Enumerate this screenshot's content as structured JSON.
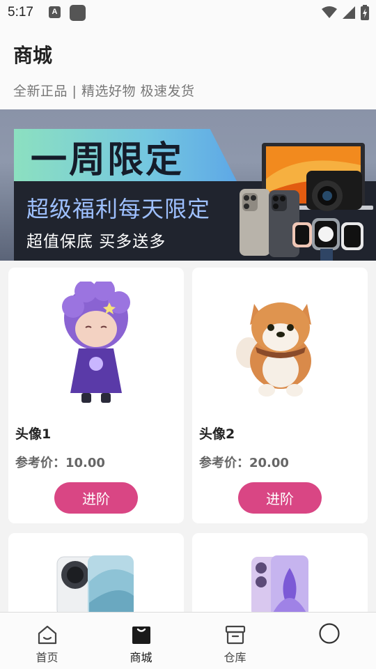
{
  "status_bar": {
    "time": "5:17",
    "a_icon": "A"
  },
  "header": {
    "title": "商城",
    "subtitle": "全新正品 | 精选好物 极速发货"
  },
  "banner": {
    "headline": "一周限定",
    "line1": "超级福利每天限定",
    "line2": "超值保底 买多送多"
  },
  "products": [
    {
      "name": "头像1",
      "price": "参考价：10.00",
      "button": "进阶",
      "icon": "purple-hair-figurine-image"
    },
    {
      "name": "头像2",
      "price": "参考价：20.00",
      "button": "进阶",
      "icon": "shiba-dog-plush-image"
    },
    {
      "icon": "white-phone-image"
    },
    {
      "icon": "purple-phone-image"
    }
  ],
  "tabbar": {
    "items": [
      {
        "label": "首页",
        "icon": "home-icon"
      },
      {
        "label": "商城",
        "icon": "shopping-bag-icon",
        "active": true
      },
      {
        "label": "仓库",
        "icon": "box-icon"
      },
      {
        "label": "",
        "icon": "profile-circle-icon"
      }
    ]
  },
  "colors": {
    "accent": "#d94684",
    "banner_text": "#9ec0ff"
  }
}
